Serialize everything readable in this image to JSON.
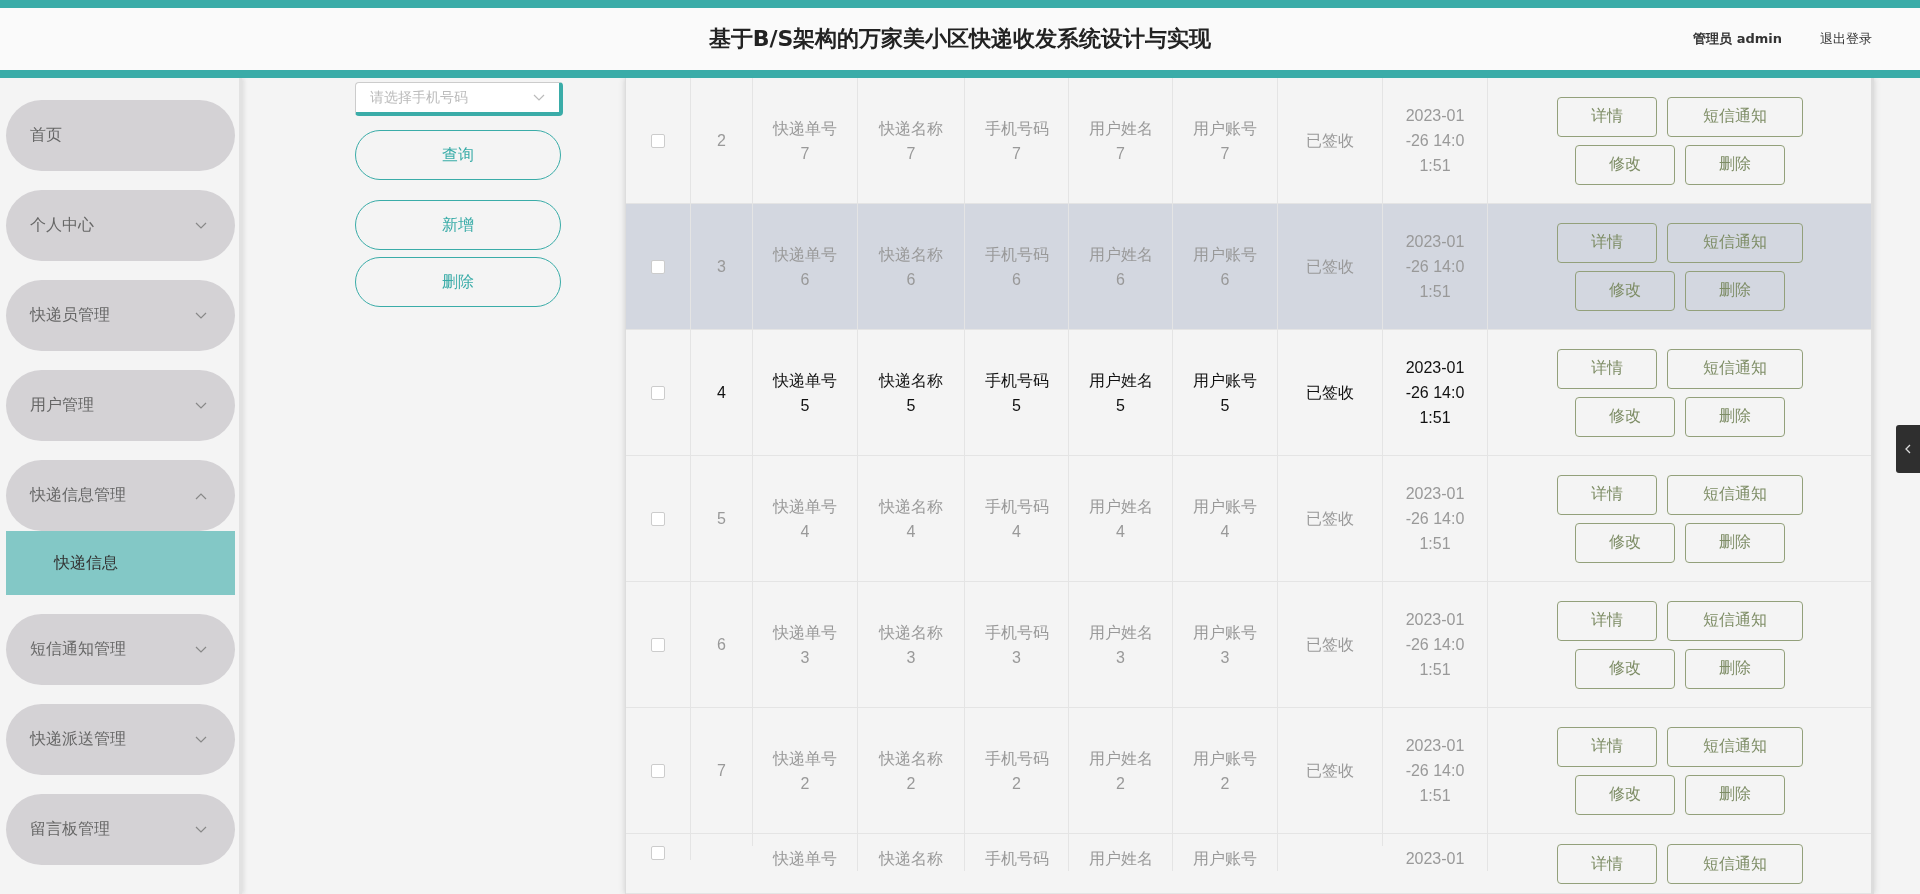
{
  "header": {
    "title": "基于B/S架构的万家美小区快递收发系统设计与实现",
    "user": "管理员 admin",
    "logout": "退出登录"
  },
  "sidebar": {
    "items": [
      {
        "label": "首页",
        "kind": "link"
      },
      {
        "label": "个人中心",
        "kind": "group",
        "expanded": false
      },
      {
        "label": "快递员管理",
        "kind": "group",
        "expanded": false
      },
      {
        "label": "用户管理",
        "kind": "group",
        "expanded": false
      },
      {
        "label": "快递信息管理",
        "kind": "group",
        "expanded": true,
        "children": [
          {
            "label": "快递信息",
            "selected": true
          }
        ]
      },
      {
        "label": "短信通知管理",
        "kind": "group",
        "expanded": false
      },
      {
        "label": "快递派送管理",
        "kind": "group",
        "expanded": false
      },
      {
        "label": "留言板管理",
        "kind": "group",
        "expanded": false
      }
    ]
  },
  "filter": {
    "select": {
      "placeholder": "请选择手机号码"
    },
    "buttons": [
      "查询",
      "新增",
      "删除"
    ]
  },
  "table": {
    "rows": [
      {
        "index": "2",
        "checked": false,
        "highlighted": false,
        "hovered": false,
        "cells": [
          "快递单号7",
          "快递名称7",
          "手机号码7",
          "用户姓名7",
          "用户账号7",
          "已签收",
          "2023-01-26 14:01:51"
        ],
        "actions": [
          "详情",
          "短信通知",
          "修改",
          "删除"
        ]
      },
      {
        "index": "3",
        "checked": false,
        "highlighted": true,
        "hovered": false,
        "cells": [
          "快递单号6",
          "快递名称6",
          "手机号码6",
          "用户姓名6",
          "用户账号6",
          "已签收",
          "2023-01-26 14:01:51"
        ],
        "actions": [
          "详情",
          "短信通知",
          "修改",
          "删除"
        ]
      },
      {
        "index": "4",
        "checked": false,
        "highlighted": false,
        "hovered": true,
        "cells": [
          "快递单号5",
          "快递名称5",
          "手机号码5",
          "用户姓名5",
          "用户账号5",
          "已签收",
          "2023-01-26 14:01:51"
        ],
        "actions": [
          "详情",
          "短信通知",
          "修改",
          "删除"
        ]
      },
      {
        "index": "5",
        "checked": false,
        "highlighted": false,
        "hovered": false,
        "cells": [
          "快递单号4",
          "快递名称4",
          "手机号码4",
          "用户姓名4",
          "用户账号4",
          "已签收",
          "2023-01-26 14:01:51"
        ],
        "actions": [
          "详情",
          "短信通知",
          "修改",
          "删除"
        ]
      },
      {
        "index": "6",
        "checked": false,
        "highlighted": false,
        "hovered": false,
        "cells": [
          "快递单号3",
          "快递名称3",
          "手机号码3",
          "用户姓名3",
          "用户账号3",
          "已签收",
          "2023-01-26 14:01:51"
        ],
        "actions": [
          "详情",
          "短信通知",
          "修改",
          "删除"
        ]
      },
      {
        "index": "7",
        "checked": false,
        "highlighted": false,
        "hovered": false,
        "cells": [
          "快递单号2",
          "快递名称2",
          "手机号码2",
          "用户姓名2",
          "用户账号2",
          "已签收",
          "2023-01-26 14:01:51"
        ],
        "actions": [
          "详情",
          "短信通知",
          "修改",
          "删除"
        ]
      },
      {
        "checked": false,
        "highlighted": false,
        "hovered": false,
        "cells": [
          "快递单号",
          "快递名称",
          "手机号码",
          "用户姓名",
          "用户账号",
          "",
          "2023-01"
        ],
        "actions": [
          "详情",
          "短信通知"
        ]
      }
    ]
  }
}
